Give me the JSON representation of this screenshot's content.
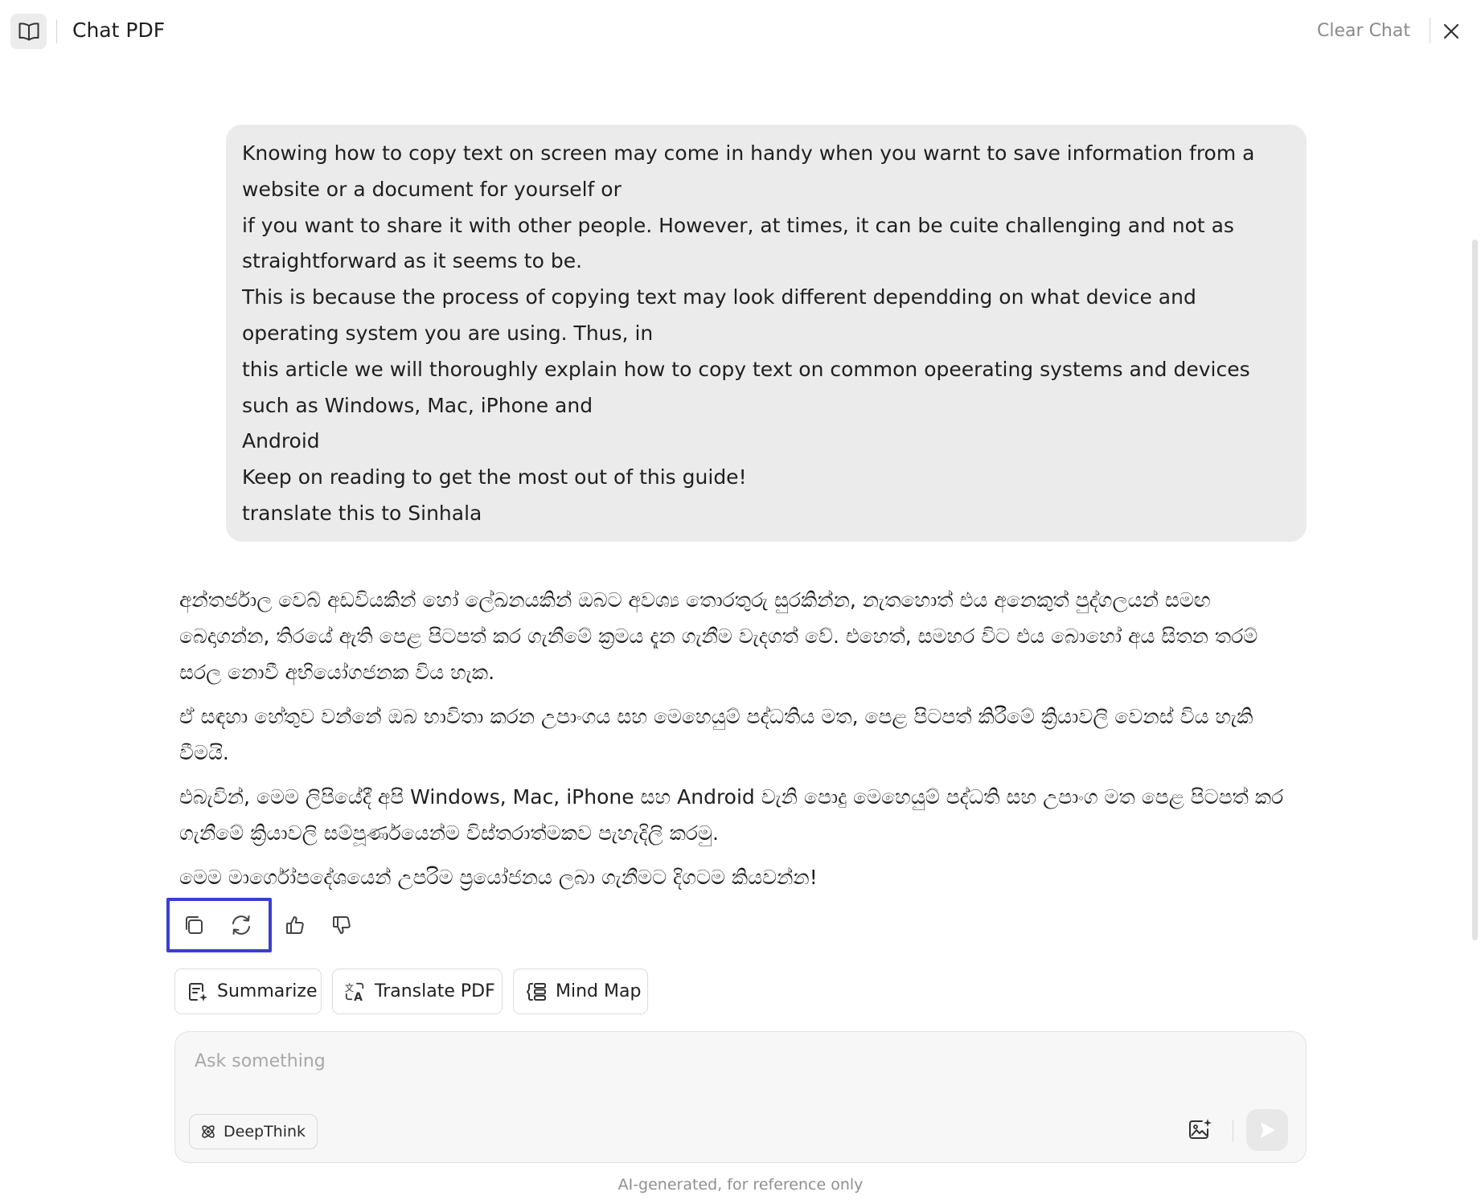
{
  "header": {
    "title": "Chat PDF",
    "clear_chat_label": "Clear Chat",
    "book_icon": "book-open-icon",
    "close_icon": "close-icon"
  },
  "user_message": {
    "lines": [
      "Knowing how to copy text on screen may come in handy when you warnt to save information from a website or a document for yourself or",
      "if you want to share it with other people. However, at times, it can be cuite challenging and not as straightforward as it seems to be.",
      "This is because the process of copying text may look different dependding on what device and operating system you are using. Thus, in",
      "this article we will thoroughly explain how to copy text on common opeerating systems and devices such as Windows, Mac, iPhone and",
      "Android",
      "Keep on reading to get the most out of this guide!",
      "translate this to Sinhala"
    ]
  },
  "assistant_message": {
    "paragraphs": [
      "අන්තර්ජාල වෙබ් අඩවියකින් හෝ ලේඛනයකින් ඔබට අවශ්‍ය තොරතුරු සුරකින්න, නැතහොත් එය අනෙකුත් පුද්ගලයන් සමඟ බෙදාගන්න, තිරයේ ඇති පෙළ පිටපත් කර ගැනීමේ ක්‍රමය දැන ගැනීම වැදගත් වේ. එහෙත්, සමහර විට එය බොහෝ අය සිතන තරම් සරල නොවී අභියෝගජනක විය හැක.",
      "ඒ සඳහා හේතුව වන්නේ ඔබ භාවිතා කරන උපාංගය සහ මෙහෙයුම් පද්ධතිය මත, පෙළ පිටපත් කිරීමේ ක්‍රියාවලි වෙනස් විය හැකි වීමයි.",
      "එබැවින්, මෙම ලිපියේදී අපි Windows, Mac, iPhone සහ Android වැනි පොදු මෙහෙයුම් පද්ධති සහ උපාංග මත පෙළ පිටපත් කර ගැනීමේ ක්‍රියාවලි සම්පූර්ණයෙන්ම විස්තරාත්මකව පැහැදිලි කරමු.",
      "මෙම මාර්ගෝපදේශයෙන් උපරිම ප්‍රයෝජනය ලබා ගැනීමට දිගටම කියවන්න!"
    ]
  },
  "message_actions": {
    "icons": [
      "copy-icon",
      "regenerate-icon",
      "thumbs-up-icon",
      "thumbs-down-icon"
    ],
    "highlight_color": "#3a3fd0"
  },
  "tools": [
    {
      "label": "Summarize",
      "icon": "summarize-icon"
    },
    {
      "label": "Translate PDF",
      "icon": "translate-icon"
    },
    {
      "label": "Mind Map",
      "icon": "mind-map-icon"
    }
  ],
  "input": {
    "placeholder": "Ask something",
    "value": "",
    "deepthink_label": "DeepThink",
    "deepthink_icon": "atom-icon",
    "image_icon": "image-sparkle-icon",
    "send_icon": "send-icon"
  },
  "footer": {
    "note": "AI-generated, for reference only"
  }
}
